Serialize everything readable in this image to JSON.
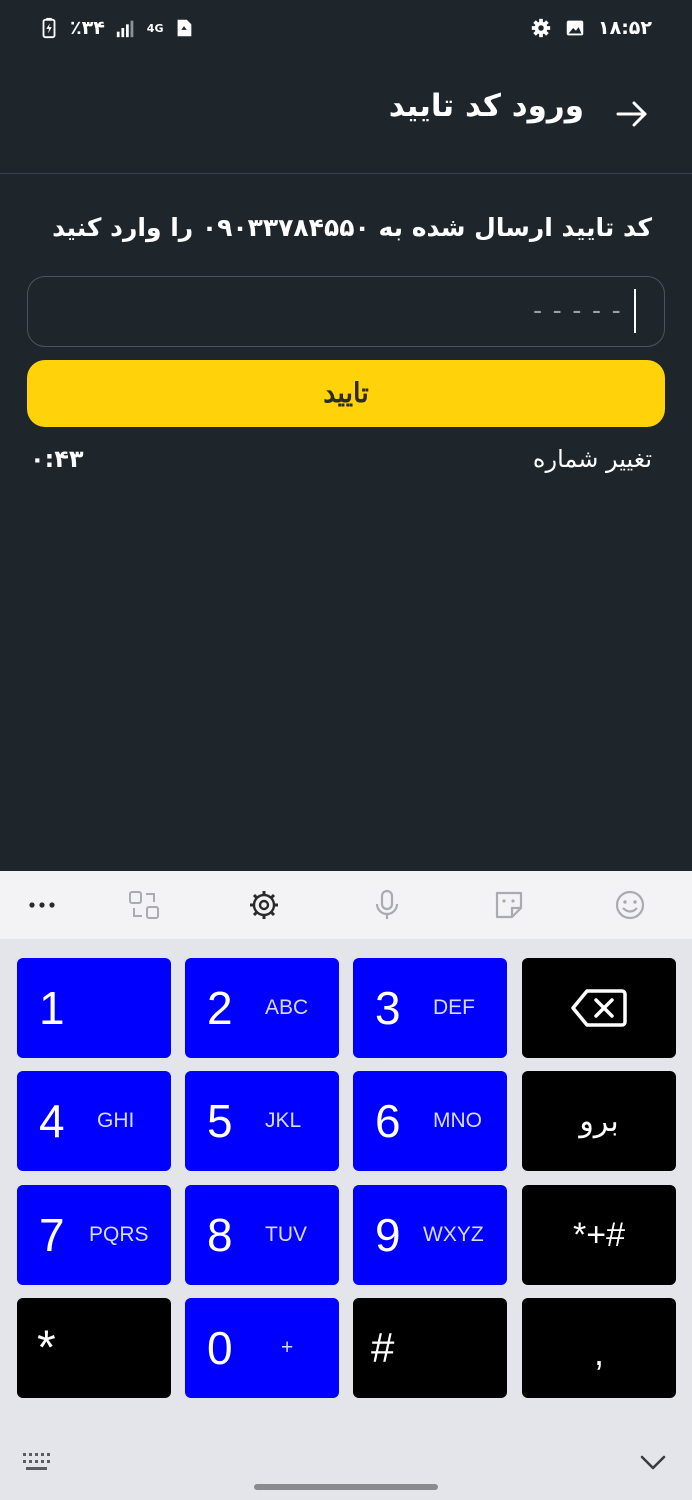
{
  "status_bar": {
    "battery": "٪۳۴",
    "network": "4G",
    "time": "۱۸:۵۲"
  },
  "app_bar": {
    "title": "ورود کد تایید"
  },
  "content": {
    "instruction": "کد تایید ارسال شده به ۰۹۰۳۳۷۸۴۵۵۰ را وارد کنید",
    "input_value": "-----",
    "confirm_label": "تایید",
    "change_number": "تغییر شماره",
    "timer": "۰:۴۳"
  },
  "keyboard": {
    "toolbar_icons": [
      "more-icon",
      "translate-icon",
      "settings-icon",
      "microphone-icon",
      "sticker-icon",
      "emoji-icon"
    ],
    "keys": {
      "k1": {
        "num": "1",
        "letters": ""
      },
      "k2": {
        "num": "2",
        "letters": "ABC"
      },
      "k3": {
        "num": "3",
        "letters": "DEF"
      },
      "k4": {
        "num": "4",
        "letters": "GHI"
      },
      "k5": {
        "num": "5",
        "letters": "JKL"
      },
      "k6": {
        "num": "6",
        "letters": "MNO"
      },
      "k7": {
        "num": "7",
        "letters": "PQRS"
      },
      "k8": {
        "num": "8",
        "letters": "TUV"
      },
      "k9": {
        "num": "9",
        "letters": "WXYZ"
      },
      "k0": {
        "num": "0",
        "letters": "+"
      },
      "star": "*",
      "hash": "#",
      "go": "برو",
      "symbols": "*+#",
      "comma": ","
    },
    "colors": {
      "blue_key": "#0000ff",
      "black_key": "#000000",
      "accent": "#ffd20a"
    }
  }
}
